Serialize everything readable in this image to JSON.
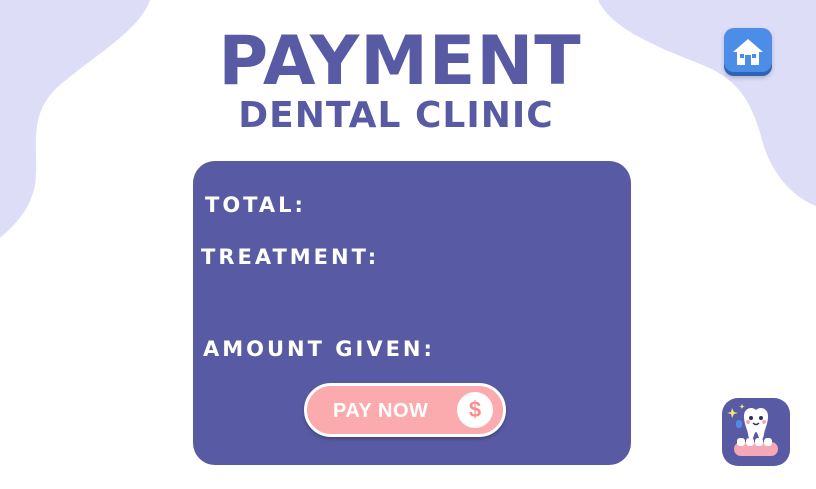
{
  "header": {
    "title": "PAYMENT",
    "subtitle": "DENTAL CLINIC"
  },
  "home_button": {
    "icon": "home-icon"
  },
  "form": {
    "total_label": "TOTAL:",
    "treatment_label": "TREATMENT:",
    "amount_label": "AMOUNT GIVEN:",
    "pay_button_label": "PAY NOW",
    "pay_icon_glyph": "$"
  },
  "decoration": {
    "icon": "tooth-mascot-icon"
  },
  "colors": {
    "primary": "#585BA3",
    "blob": "#DDDDF7",
    "pay_button": "#FBABAD",
    "home_button": "#4C8DE8"
  }
}
